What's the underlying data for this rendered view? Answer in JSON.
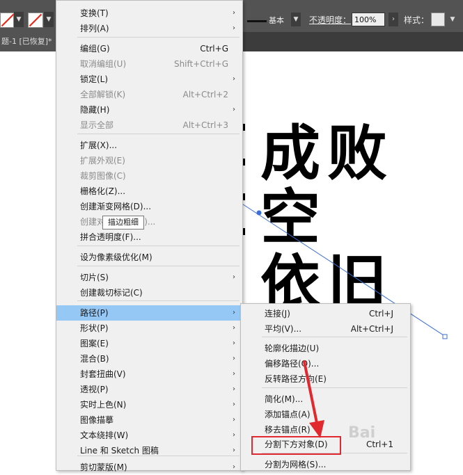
{
  "control_bar": {
    "stroke_style_label": "基本",
    "opacity_label": "不透明度：",
    "opacity_value": "100%",
    "style_label": "样式："
  },
  "document_tab": {
    "title": "题-1 [已恢复]*"
  },
  "artwork": {
    "line1": "成败",
    "line2": "空",
    "line3": "依旧"
  },
  "tooltip": {
    "text": "描边粗细"
  },
  "watermark": {
    "text": "Bai"
  },
  "object_menu": {
    "items": [
      {
        "label": "变换(T)",
        "submenu": true
      },
      {
        "label": "排列(A)",
        "submenu": true
      },
      {
        "label": "编组(G)",
        "shortcut": "Ctrl+G"
      },
      {
        "label": "取消编组(U)",
        "shortcut": "Shift+Ctrl+G",
        "disabled": true
      },
      {
        "label": "锁定(L)",
        "submenu": true
      },
      {
        "label": "全部解锁(K)",
        "shortcut": "Alt+Ctrl+2",
        "disabled": true
      },
      {
        "label": "隐藏(H)",
        "submenu": true
      },
      {
        "label": "显示全部",
        "shortcut": "Alt+Ctrl+3",
        "disabled": true
      },
      {
        "label": "扩展(X)..."
      },
      {
        "label": "扩展外观(E)",
        "disabled": true
      },
      {
        "label": "裁剪图像(C)",
        "disabled": true
      },
      {
        "label": "栅格化(Z)..."
      },
      {
        "label": "创建渐变网格(D)..."
      },
      {
        "label": "创建对象马赛克(J)...",
        "disabled": true
      },
      {
        "label": "拼合透明度(F)..."
      },
      {
        "label": "设为像素级优化(M)"
      },
      {
        "label": "切片(S)",
        "submenu": true
      },
      {
        "label": "创建裁切标记(C)"
      },
      {
        "label": "路径(P)",
        "submenu": true,
        "highlighted": true
      },
      {
        "label": "形状(P)",
        "submenu": true
      },
      {
        "label": "图案(E)",
        "submenu": true
      },
      {
        "label": "混合(B)",
        "submenu": true
      },
      {
        "label": "封套扭曲(V)",
        "submenu": true
      },
      {
        "label": "透视(P)",
        "submenu": true
      },
      {
        "label": "实时上色(N)",
        "submenu": true
      },
      {
        "label": "图像描摹",
        "submenu": true
      },
      {
        "label": "文本绕排(W)",
        "submenu": true
      },
      {
        "label": "Line 和 Sketch 图稿",
        "submenu": true
      },
      {
        "label": "剪切蒙版(M)",
        "submenu": true
      }
    ]
  },
  "path_submenu": {
    "items": [
      {
        "label": "连接(J)",
        "shortcut": "Ctrl+J"
      },
      {
        "label": "平均(V)...",
        "shortcut": "Alt+Ctrl+J"
      },
      {
        "label": "轮廓化描边(U)"
      },
      {
        "label": "偏移路径(O)..."
      },
      {
        "label": "反转路径方向(E)"
      },
      {
        "label": "简化(M)..."
      },
      {
        "label": "添加锚点(A)"
      },
      {
        "label": "移去锚点(R)"
      },
      {
        "label": "分割下方对象(D)",
        "shortcut": "Ctrl+1",
        "annotated": true
      },
      {
        "label": "分割为网格(S)..."
      }
    ]
  },
  "colors": {
    "highlight": "#96c8f5",
    "annotation_red": "#e0282e",
    "path_blue": "#3a6fd8"
  }
}
